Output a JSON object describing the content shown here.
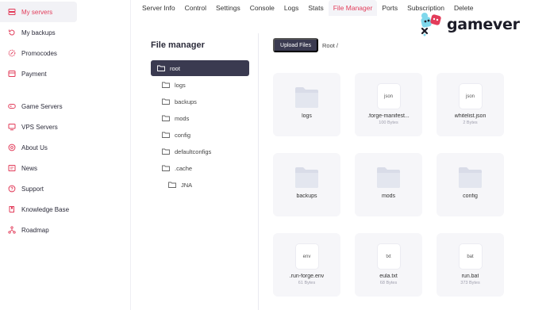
{
  "sidebar": {
    "items": [
      {
        "label": "My servers",
        "icon": "server-icon"
      },
      {
        "label": "My backups",
        "icon": "backup-icon"
      },
      {
        "label": "Promocodes",
        "icon": "promo-icon"
      },
      {
        "label": "Payment",
        "icon": "payment-icon"
      },
      {
        "label": "Game Servers",
        "icon": "gamepad-icon"
      },
      {
        "label": "VPS Servers",
        "icon": "vps-icon"
      },
      {
        "label": "About Us",
        "icon": "about-icon"
      },
      {
        "label": "News",
        "icon": "news-icon"
      },
      {
        "label": "Support",
        "icon": "support-icon"
      },
      {
        "label": "Knowledge Base",
        "icon": "knowledge-icon"
      },
      {
        "label": "Roadmap",
        "icon": "roadmap-icon"
      }
    ],
    "active": "My servers"
  },
  "tabs": [
    "Server Info",
    "Control",
    "Settings",
    "Console",
    "Logs",
    "Stats",
    "File Manager",
    "Ports",
    "Subscription",
    "Delete"
  ],
  "active_tab": "File Manager",
  "logo": {
    "text": "gamever"
  },
  "file_manager": {
    "title": "File manager",
    "tree": [
      {
        "label": "root",
        "selected": true
      },
      {
        "label": "logs"
      },
      {
        "label": "backups"
      },
      {
        "label": "mods"
      },
      {
        "label": "config"
      },
      {
        "label": "defaultconfigs"
      },
      {
        "label": ".cache"
      },
      {
        "label": "JNA"
      }
    ],
    "upload_label": "Upload Files",
    "breadcrumb": "Root /",
    "files": [
      {
        "name": "logs",
        "type": "folder"
      },
      {
        "name": ".forge-manifest...",
        "type": "file",
        "ext": "json",
        "size": "100 Bytes"
      },
      {
        "name": "whitelist.json",
        "type": "file",
        "ext": "json",
        "size": "2 Bytes"
      },
      {
        "name": "backups",
        "type": "folder"
      },
      {
        "name": "mods",
        "type": "folder"
      },
      {
        "name": "config",
        "type": "folder"
      },
      {
        "name": ".run-forge.env",
        "type": "file",
        "ext": "env",
        "size": "61 Bytes"
      },
      {
        "name": "eula.txt",
        "type": "file",
        "ext": "txt",
        "size": "68 Bytes"
      },
      {
        "name": "run.bat",
        "type": "file",
        "ext": "bat",
        "size": "373 Bytes"
      }
    ]
  },
  "colors": {
    "accent": "#e23c5a",
    "dark": "#3a3a50",
    "card": "#f6f6f9",
    "folder": "#d9dce8"
  }
}
